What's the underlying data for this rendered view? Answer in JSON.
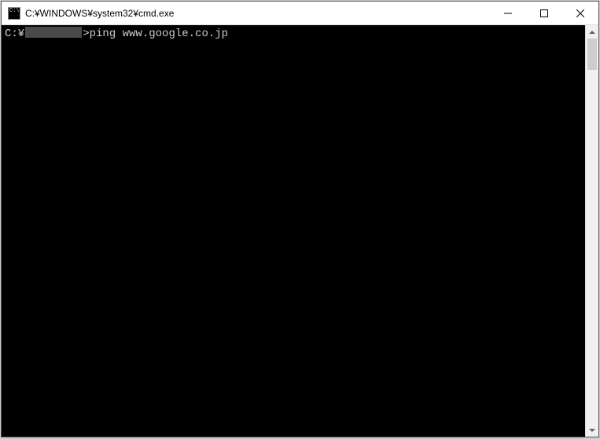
{
  "titlebar": {
    "title": "C:¥WINDOWS¥system32¥cmd.exe"
  },
  "terminal": {
    "prompt_prefix": "C:¥",
    "prompt_suffix": ">",
    "command": "ping www.google.co.jp"
  }
}
